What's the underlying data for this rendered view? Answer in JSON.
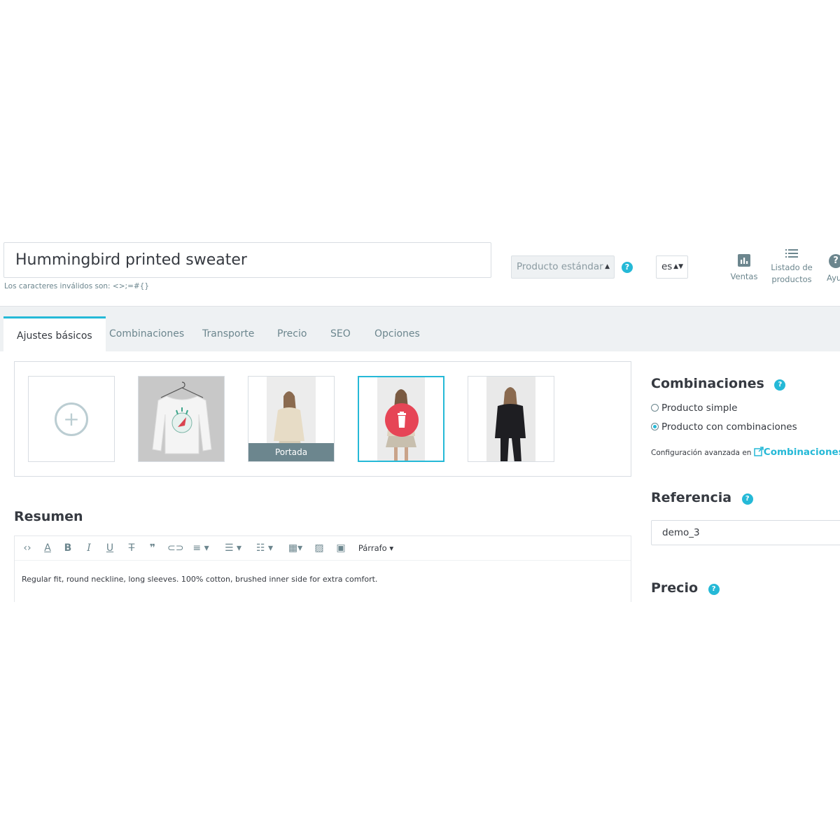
{
  "header": {
    "product_name": "Hummingbird printed sweater",
    "invalid_chars": "Los caracteres inválidos son: <>;=#{}",
    "product_type": "Producto estándar",
    "language": "es",
    "toolbar": {
      "sales_label": "Ventas",
      "list_label_line1": "Listado de",
      "list_label_line2": "productos",
      "help_label": "Ayu"
    }
  },
  "tabs": [
    {
      "label": "Ajustes básicos",
      "active": true
    },
    {
      "label": "Combinaciones"
    },
    {
      "label": "Transporte"
    },
    {
      "label": "Precio"
    },
    {
      "label": "SEO"
    },
    {
      "label": "Opciones"
    }
  ],
  "images": {
    "cover_label": "Portada"
  },
  "summary": {
    "title": "Resumen",
    "format_label": "Párrafo",
    "text": "Regular fit, round neckline, long sleeves. 100% cotton, brushed inner side for extra comfort."
  },
  "combinations": {
    "title": "Combinaciones",
    "option_simple": "Producto simple",
    "option_combinations": "Producto con combinaciones",
    "selected": "option_combinations",
    "advanced_text": "Configuración avanzada en",
    "advanced_link": "Combinaciones"
  },
  "reference": {
    "title": "Referencia",
    "value": "demo_3"
  },
  "price": {
    "title": "Precio"
  },
  "colors": {
    "accent": "#25b9d7",
    "danger": "#e64556",
    "muted": "#6c868e"
  }
}
